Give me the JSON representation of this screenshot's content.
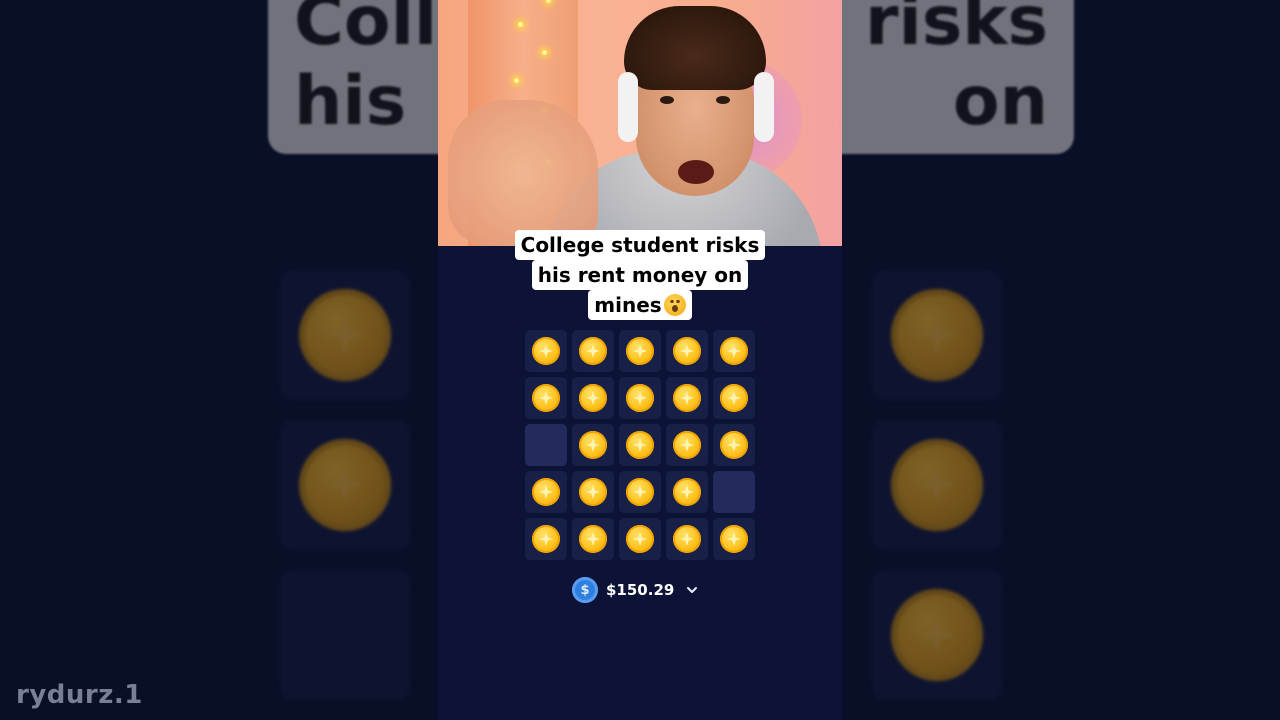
{
  "caption": {
    "line1": "College student risks",
    "line2": "his rent money on",
    "line3": "mines"
  },
  "background_caption": {
    "left_line1": "Colle",
    "left_line2": "his",
    "right_line1": "risks",
    "right_line2": "on"
  },
  "board": {
    "rows": 5,
    "cols": 5,
    "tiles": [
      [
        "coin",
        "coin",
        "coin",
        "coin",
        "coin"
      ],
      [
        "coin",
        "coin",
        "coin",
        "coin",
        "coin"
      ],
      [
        "empty",
        "coin",
        "coin",
        "coin",
        "coin"
      ],
      [
        "coin",
        "coin",
        "coin",
        "coin",
        "empty"
      ],
      [
        "coin",
        "coin",
        "coin",
        "coin",
        "coin"
      ]
    ]
  },
  "wallet": {
    "currency_icon": "dollar-coin-icon",
    "currency_symbol": "$",
    "amount": "$150.29",
    "dropdown_icon": "chevron-down-icon"
  },
  "watermark": "rydurz.1",
  "colors": {
    "background": "#0c1337",
    "tile": "#182048",
    "tile_empty": "#242b5c",
    "coin": "#ffc21d",
    "currency": "#2f7fe0"
  }
}
